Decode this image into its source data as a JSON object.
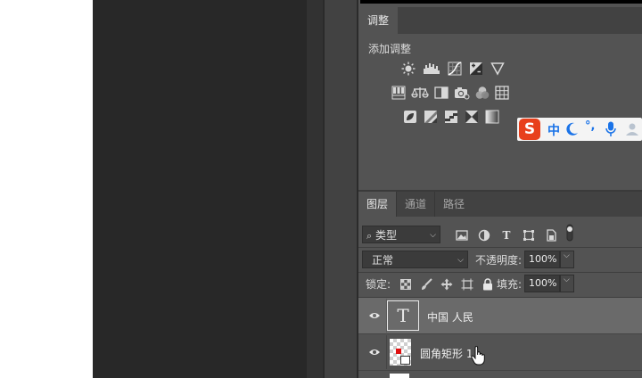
{
  "adjustments": {
    "tab_label": "调整",
    "add_adjustment_label": "添加调整",
    "row1_icons": [
      "brightness-contrast-icon",
      "levels-icon",
      "curves-icon",
      "exposure-icon",
      "vibrance-icon"
    ],
    "row2_icons": [
      "hue-saturation-icon",
      "color-balance-icon",
      "black-white-icon",
      "photo-filter-icon",
      "channel-mixer-icon",
      "color-lookup-icon"
    ],
    "row3_icons": [
      "invert-icon",
      "posterize-icon",
      "threshold-icon",
      "selective-color-icon",
      "gradient-map-icon"
    ]
  },
  "ime": {
    "lang_label": "中",
    "punct_label": "°,"
  },
  "layers": {
    "tabs": [
      "图层",
      "通道",
      "路径"
    ],
    "filter_label": "类型",
    "blend_mode": "正常",
    "opacity_label": "不透明度:",
    "opacity_value": "100%",
    "lock_label": "锁定:",
    "fill_label": "填充:",
    "fill_value": "100%",
    "items": [
      {
        "name": "中国 人民",
        "type": "text",
        "selected": true
      },
      {
        "name": "圆角矩形 1",
        "type": "shape",
        "selected": false
      }
    ]
  },
  "colors": {
    "panel_bg": "#535353",
    "selected_row": "#6a6a6a",
    "ime_red": "#e8401c",
    "ime_blue": "#1a73e8"
  }
}
